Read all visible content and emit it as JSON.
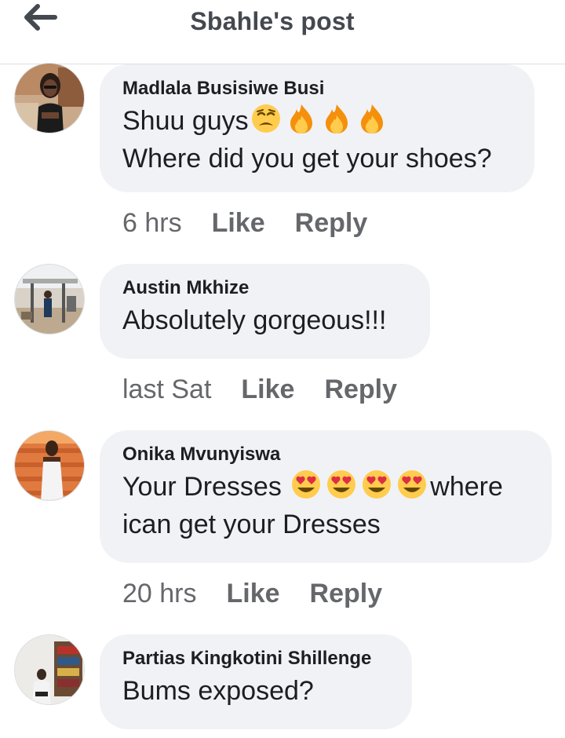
{
  "header": {
    "title": "Sbahle's post",
    "back_icon": "arrow-left-icon"
  },
  "colors": {
    "bubble": "#f0f2f5",
    "meta_text": "#65676b",
    "title_text": "#444950"
  },
  "comments": [
    {
      "author": "Madlala Busisiwe Busi",
      "line1_text": "Shuu guys",
      "line1_emojis": [
        "weary-face-emoji",
        "fire-emoji",
        "fire-emoji",
        "fire-emoji"
      ],
      "line2_text": "Where did you get your shoes?",
      "time": "6 hrs",
      "like_label": "Like",
      "reply_label": "Reply"
    },
    {
      "author": "Austin Mkhize",
      "line1_text": "Absolutely gorgeous!!!",
      "time": "last Sat",
      "like_label": "Like",
      "reply_label": "Reply"
    },
    {
      "author": "Onika Mvunyiswa",
      "line1_text_before": "Your Dresses ",
      "line1_emojis": [
        "heart-eyes-emoji",
        "heart-eyes-emoji",
        "heart-eyes-emoji",
        "heart-eyes-emoji"
      ],
      "line1_text_after": "where",
      "line2_text": "ican get your Dresses",
      "time": "20 hrs",
      "like_label": "Like",
      "reply_label": "Reply"
    },
    {
      "author": "Partias Kingkotini Shillenge",
      "line1_text": "Bums exposed?"
    }
  ]
}
